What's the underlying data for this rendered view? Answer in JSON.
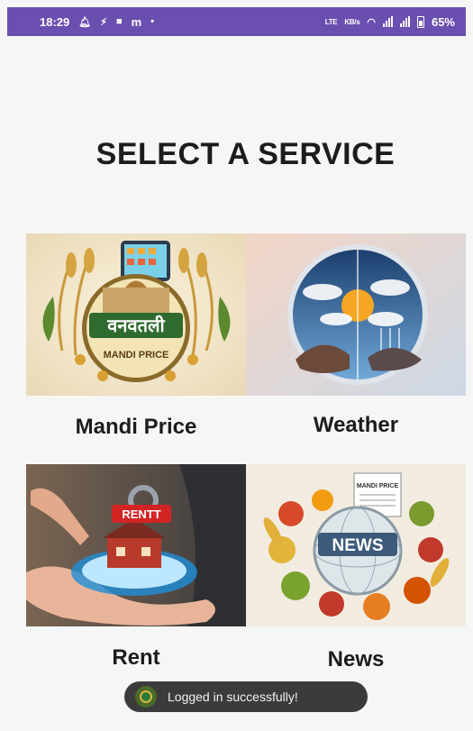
{
  "status_bar": {
    "time": "18:29",
    "notif_m": "m",
    "lte1": "LTE",
    "speed": "KB/s",
    "battery": "65%"
  },
  "page": {
    "title": "SELECT A SERVICE"
  },
  "services": [
    {
      "label": "Mandi Price",
      "logo_text": "वनवतली",
      "logo_sub": "MANDI PRICE"
    },
    {
      "label": "Weather"
    },
    {
      "label": "Rent",
      "badge": "RENTT"
    },
    {
      "label": "News",
      "banner": "NEWS",
      "paper": "MANDI PRICE"
    }
  ],
  "toast": {
    "message": "Logged in successfully!"
  },
  "colors": {
    "status_bar": "#6a4fb0",
    "toast_bg": "#3b3b3b",
    "title": "#1c1c1c"
  }
}
